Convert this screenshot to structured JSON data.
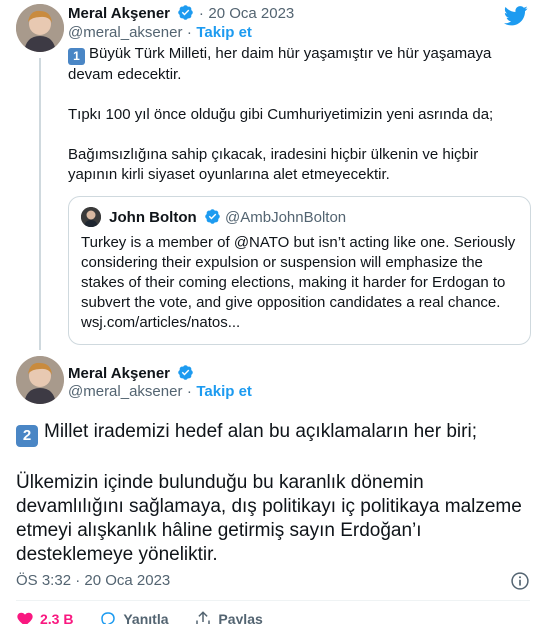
{
  "colors": {
    "link": "#1d9bf0",
    "muted": "#536471",
    "text": "#0f1419",
    "like": "#f91880"
  },
  "tweet1": {
    "author": "Meral Akşener",
    "date": "20 Oca 2023",
    "handle": "@meral_aksener",
    "follow": "Takip et",
    "separator": "·",
    "key_emoji": "1",
    "lines": [
      "Büyük Türk Milleti, her daim hür yaşamıştır ve hür yaşamaya devam edecektir.",
      "Tıpkı 100 yıl önce olduğu gibi Cumhuriyetimizin yeni asrında da;",
      "Bağımsızlığına sahip çıkacak, iradesini hiçbir ülkenin ve hiçbir yapının kirli siyaset oyunlarına alet etmeyecektir."
    ]
  },
  "quote": {
    "author": "John Bolton",
    "handle": "@AmbJohnBolton",
    "text": "Turkey is a member of @NATO but isn’t acting like one. Seriously considering their expulsion or suspension will emphasize the stakes of their coming elections, making it harder for Erdogan to subvert the vote, and give opposition candidates a real chance. wsj.com/articles/natos..."
  },
  "tweet2": {
    "author": "Meral Akşener",
    "handle": "@meral_aksener",
    "follow": "Takip et",
    "separator": "·",
    "key_emoji": "2",
    "lines": [
      "Millet irademizi hedef alan bu açıklamaların her biri;",
      "Ülkemizin içinde bulunduğu bu karanlık dönemin devamlılığını sağlamaya, dış politikayı iç politikaya malzeme etmeyi alışkanlık hâline getirmiş sayın Erdoğan’ı desteklemeye yöneliktir."
    ],
    "timestamp": "ÖS 3:32 · 20 Oca 2023"
  },
  "actions": {
    "likes": "2,3 B",
    "reply_label": "Yanıtla",
    "share_label": "Paylaş"
  },
  "icons": [
    "verified-badge-icon",
    "twitter-bird-icon",
    "info-icon",
    "heart-icon",
    "reply-icon",
    "share-icon"
  ]
}
